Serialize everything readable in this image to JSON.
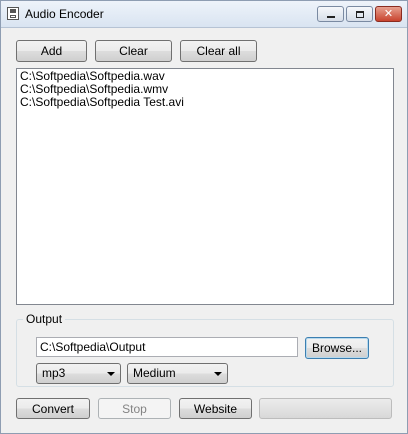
{
  "window": {
    "title": "Audio Encoder",
    "icon": "floppy-disk-icon",
    "controls": [
      "minimize-icon",
      "maximize-icon",
      "close-icon"
    ]
  },
  "toolbar": {
    "add_label": "Add",
    "clear_label": "Clear",
    "clear_all_label": "Clear all"
  },
  "files": [
    "C:\\Softpedia\\Softpedia.wav",
    "C:\\Softpedia\\Softpedia.wmv",
    "C:\\Softpedia\\Softpedia Test.avi"
  ],
  "output": {
    "group_label": "Output",
    "path_value": "C:\\Softpedia\\Output",
    "browse_label": "Browse...",
    "format_selected": "mp3",
    "quality_selected": "Medium"
  },
  "actions": {
    "convert_label": "Convert",
    "stop_label": "Stop",
    "website_label": "Website"
  },
  "progress": {
    "value": 0
  },
  "colors": {
    "window_bg": "#f0f0f0",
    "close_button": "#c8432e",
    "progress_fill": "#37b51f"
  }
}
